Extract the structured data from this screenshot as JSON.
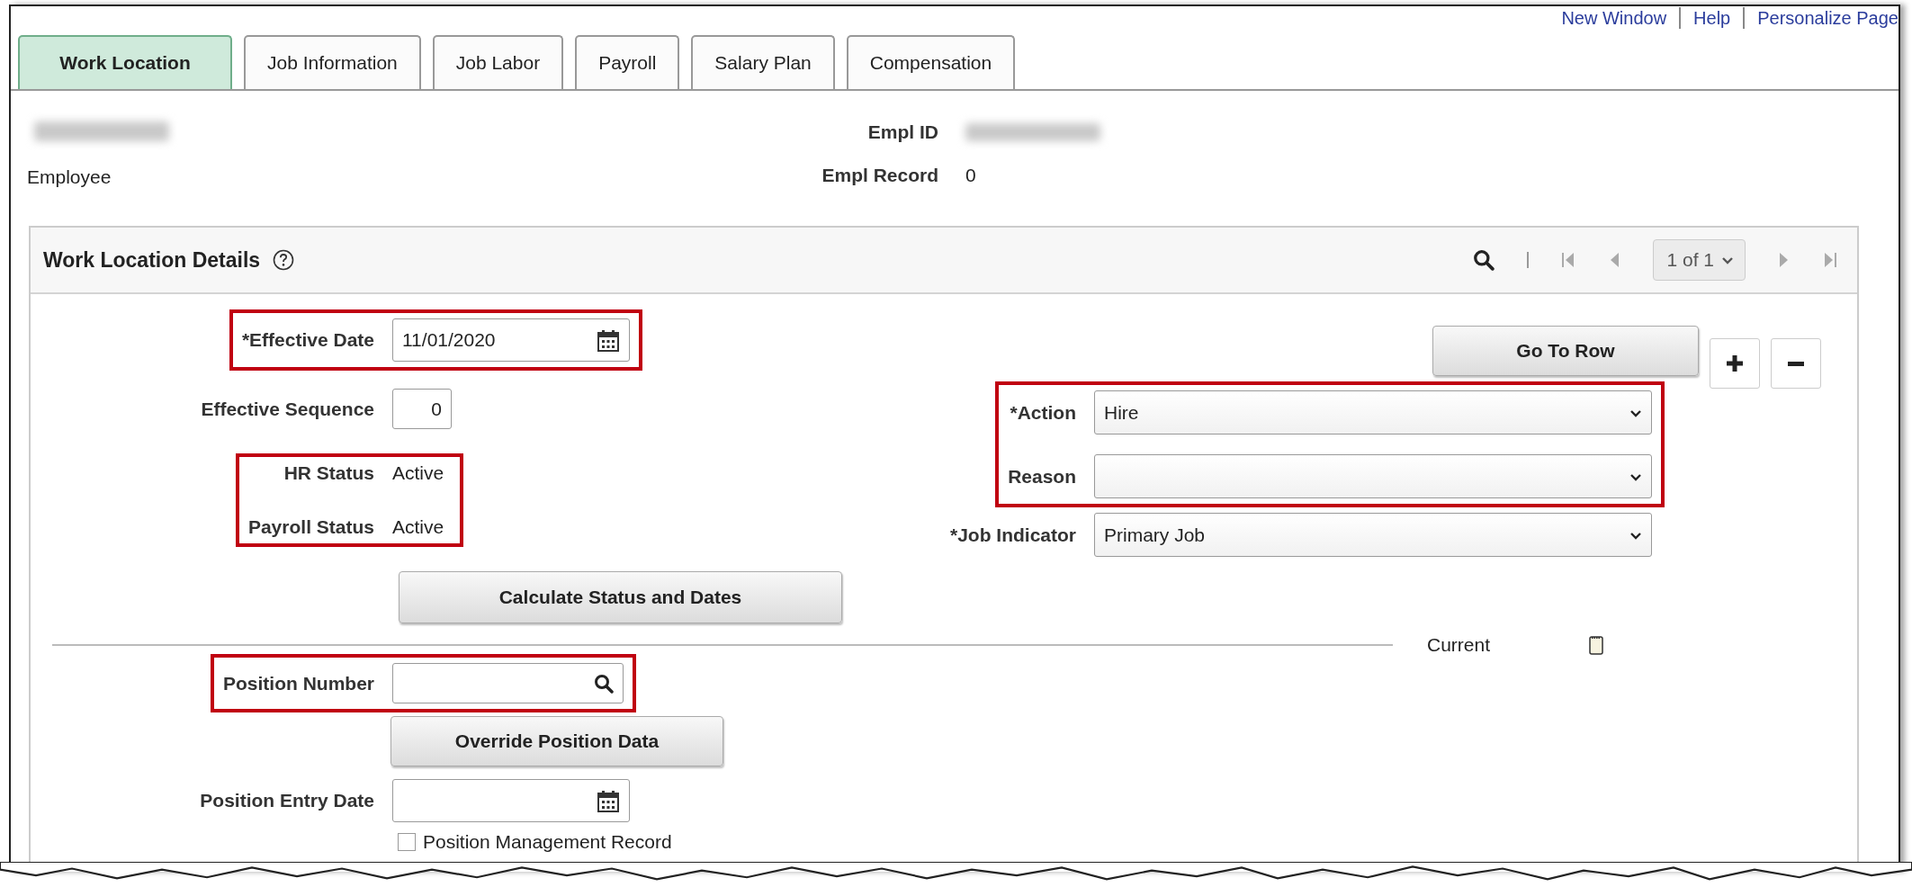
{
  "header_links": [
    {
      "label": "New Window"
    },
    {
      "label": "Help"
    },
    {
      "label": "Personalize Page"
    }
  ],
  "tabs": [
    {
      "label": "Work Location",
      "selected": true
    },
    {
      "label": "Job Information",
      "selected": false
    },
    {
      "label": "Job Labor",
      "selected": false
    },
    {
      "label": "Payroll",
      "selected": false
    },
    {
      "label": "Salary Plan",
      "selected": false
    },
    {
      "label": "Compensation",
      "selected": false
    }
  ],
  "employee": {
    "role": "Employee",
    "fields": [
      {
        "label": "Empl ID",
        "kind": "redacted"
      },
      {
        "label": "Empl Record",
        "kind": "text",
        "value": "0"
      }
    ]
  },
  "section": {
    "title": "Work Location Details",
    "pager": "1 of 1",
    "go_to_row": "Go To Row",
    "left": [
      {
        "kind": "group",
        "highlighted": true,
        "rows": [
          {
            "kind": "date",
            "label": "*Effective Date",
            "value": "11/01/2020"
          }
        ]
      },
      {
        "kind": "group",
        "highlighted": false,
        "rows": [
          {
            "kind": "number",
            "label": "Effective Sequence",
            "value": "0"
          }
        ]
      },
      {
        "kind": "group",
        "highlighted": true,
        "rows": [
          {
            "kind": "status",
            "label": "HR Status",
            "value": "Active"
          },
          {
            "kind": "status",
            "label": "Payroll Status",
            "value": "Active"
          }
        ]
      },
      {
        "kind": "button",
        "label": "Calculate Status and Dates"
      }
    ],
    "right": [
      {
        "kind": "group",
        "highlighted": true,
        "rows": [
          {
            "kind": "select",
            "label": "*Action",
            "value": "Hire"
          },
          {
            "kind": "select",
            "label": "Reason"
          }
        ]
      },
      {
        "kind": "group",
        "highlighted": false,
        "rows": [
          {
            "kind": "select",
            "label": "*Job Indicator",
            "value": "Primary Job"
          }
        ]
      }
    ],
    "current_label": "Current",
    "position": [
      {
        "kind": "group",
        "highlighted": true,
        "rows": [
          {
            "kind": "search",
            "label": "Position Number"
          }
        ]
      },
      {
        "kind": "button",
        "label": "Override Position Data"
      },
      {
        "kind": "group",
        "highlighted": false,
        "rows": [
          {
            "kind": "date",
            "label": "Position Entry Date"
          }
        ]
      },
      {
        "kind": "checkbox",
        "label": "Position Management Record",
        "checked": false
      }
    ]
  }
}
